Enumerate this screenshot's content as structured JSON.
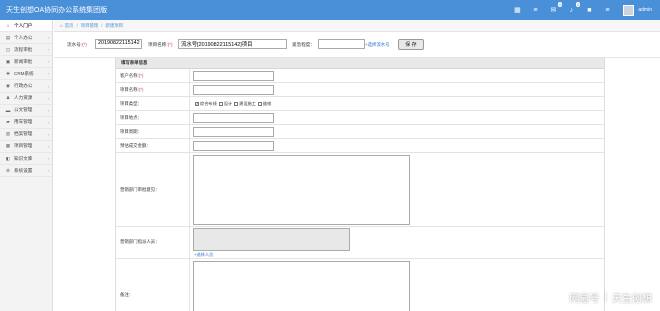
{
  "app": {
    "title": "天生创想OA协同办公系统集团版",
    "username": "admin"
  },
  "topbar": {
    "icons": [
      {
        "name": "grid-icon",
        "glyph": "▦",
        "badge": ""
      },
      {
        "name": "list-icon",
        "glyph": "≡",
        "badge": ""
      },
      {
        "name": "chat-icon",
        "glyph": "✉",
        "badge": "0"
      },
      {
        "name": "bell-icon",
        "glyph": "♪",
        "badge": "0"
      },
      {
        "name": "message-icon",
        "glyph": "■",
        "badge": ""
      },
      {
        "name": "menu-icon",
        "glyph": "≡",
        "badge": ""
      }
    ]
  },
  "sidebar": {
    "items": [
      {
        "icon": "⌂",
        "label": "个人门户",
        "active": true,
        "arrow": ""
      },
      {
        "icon": "▤",
        "label": "个人办公",
        "active": false,
        "arrow": "‹"
      },
      {
        "icon": "◫",
        "label": "流程审批",
        "active": false,
        "arrow": "‹"
      },
      {
        "icon": "▣",
        "label": "新闻审批",
        "active": false,
        "arrow": "‹"
      },
      {
        "icon": "✚",
        "label": "CRM系统",
        "active": false,
        "arrow": "‹"
      },
      {
        "icon": "◉",
        "label": "行政办公",
        "active": false,
        "arrow": "‹"
      },
      {
        "icon": "♟",
        "label": "人力资源",
        "active": false,
        "arrow": "‹"
      },
      {
        "icon": "▬",
        "label": "公文管理",
        "active": false,
        "arrow": "‹"
      },
      {
        "icon": "▰",
        "label": "用车管理",
        "active": false,
        "arrow": "‹"
      },
      {
        "icon": "▥",
        "label": "档案管理",
        "active": false,
        "arrow": "‹"
      },
      {
        "icon": "▦",
        "label": "项目管理",
        "active": false,
        "arrow": "‹"
      },
      {
        "icon": "◧",
        "label": "知识文库",
        "active": false,
        "arrow": "‹"
      },
      {
        "icon": "⚙",
        "label": "系统设置",
        "active": false,
        "arrow": "‹"
      }
    ]
  },
  "breadcrumb": {
    "items": [
      "首页",
      "项目管理",
      "新建项目"
    ]
  },
  "header": {
    "serial_label": "流水号:",
    "serial_req": "(*)",
    "serial_value": "20190822115142",
    "name_label": "项目名称:",
    "name_req": "(*)",
    "name_value": "流水号[20190822115142]项目",
    "urgency_label": "紧急程度：",
    "urgency_value": "",
    "choose_flow": "+选择流水号",
    "save": "保 存"
  },
  "form": {
    "title": "填写表单信息",
    "fields": {
      "client": {
        "label": "客户名称:",
        "req": "(*)"
      },
      "project": {
        "label": "项目名称:",
        "req": "(*)"
      },
      "type": {
        "label": "项目类型："
      },
      "location": {
        "label": "项目地点："
      },
      "cycle": {
        "label": "项目周期："
      },
      "amount": {
        "label": "预估成交金额："
      },
      "opinion": {
        "label": "营销部门审批意见："
      },
      "assign": {
        "label": "营销部门指派人员："
      },
      "remark": {
        "label": "备注："
      }
    },
    "type_options": [
      {
        "label": "综合布线",
        "checked": true
      },
      {
        "label": "设计",
        "checked": false
      },
      {
        "label": "建设施工",
        "checked": false
      },
      {
        "label": "维修",
        "checked": false
      }
    ],
    "select_person": "+选择人员"
  },
  "watermark": {
    "left": "网易号",
    "sep": "|",
    "right": "天生创想"
  }
}
